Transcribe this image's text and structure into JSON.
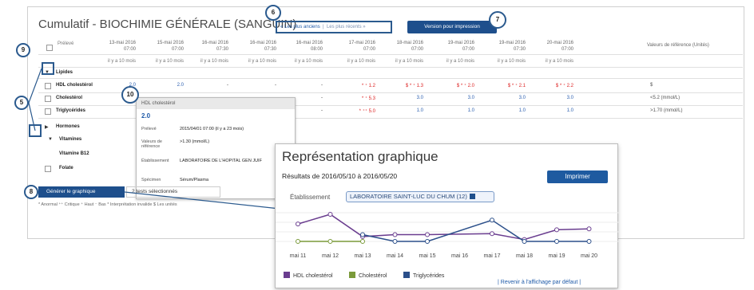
{
  "title": "Cumulatif - BIOCHIMIE GÉNÉRALE (SANGUIN)",
  "sort": {
    "oldest": "« Les plus anciens",
    "newest": "Les plus récents »"
  },
  "print_version": "Version pour impression",
  "header": {
    "preleve": "Prélevé",
    "ref": "Valeurs de référence (Unités)",
    "dates": [
      [
        "13-mai 2016",
        "07:00"
      ],
      [
        "15-mai 2016",
        "07:00"
      ],
      [
        "16-mai 2016",
        "07:30"
      ],
      [
        "16-mai 2016",
        "07:30"
      ],
      [
        "16-mai 2016",
        "08:00"
      ],
      [
        "17-mai 2016",
        "07:00"
      ],
      [
        "18-mai 2016",
        "07:00"
      ],
      [
        "19-mai 2016",
        "07:00"
      ],
      [
        "19-mai 2016",
        "07:30"
      ],
      [
        "20-mai 2016",
        "07:00"
      ]
    ],
    "ago": "il y a 10 mois"
  },
  "groups": {
    "lipides": "Lipides",
    "hormones": "Hormones",
    "vitamines": "Vitamines",
    "vitb12": "Vitamine B12",
    "folate": "Folate"
  },
  "rows": [
    {
      "name": "HDL cholestérol",
      "vals": [
        "2.0",
        "2.0",
        "-",
        "-",
        "-",
        "* ⁺ 1.2",
        "$ * ⁺ 1.3",
        "$ * ⁺ 2.0",
        "$ * ⁺ 2.1",
        "$ * ⁺ 2.2"
      ],
      "ref": "$"
    },
    {
      "name": "Cholestérol",
      "vals": [
        "",
        "",
        "-",
        "-",
        "-",
        "* ⁺ 5.3",
        "3.0",
        "3.0",
        "3.0",
        "3.0"
      ],
      "ref": "<5.2 (mmol/L)"
    },
    {
      "name": "Triglycérides",
      "vals": [
        "",
        "",
        "-",
        "-",
        "-",
        "* ⁺⁺ 5.0",
        "1.0",
        "1.0",
        "1.0",
        "1.0"
      ],
      "ref": ">1.70 (mmol/L)"
    }
  ],
  "popup": {
    "title": "HDL cholestérol",
    "value": "2.0",
    "l1": "Prélevé",
    "v1": "2015/04/01 07:00 (il y a 23 mois)",
    "l2": "Valeurs de référence",
    "v2": ">1.30 (mmol/L)",
    "l3": "Établissement",
    "v3": "LABORATOIRE DE L'HOPITAL GEN JUIF",
    "l4": "Spécimen",
    "v4": "Sérum/Plasma"
  },
  "generate": "Générer le graphique",
  "selected": "2 tests sélectionnés",
  "legend_text": "* Anormal   ⁺⁺ Critique   ⁺ Haut   ⁻ Bas   * Interprétation invalide   $ Les unités",
  "callouts": [
    "5",
    "6",
    "7",
    "8",
    "9",
    "10"
  ],
  "graph": {
    "title": "Représentation graphique",
    "range": "Résultats de 2016/05/10 à 2016/05/20",
    "print": "Imprimer",
    "estab_label": "Établissement",
    "estab": "LABORATOIRE SAINT-LUC DU CHUM (12)",
    "reset": "| Revenir à l'affichage par défaut |",
    "legend": [
      {
        "name": "HDL cholestérol",
        "color": "#6a3d8f"
      },
      {
        "name": "Cholestérol",
        "color": "#7a9a3a"
      },
      {
        "name": "Triglycérides",
        "color": "#2b4f8a"
      }
    ]
  },
  "chart_data": {
    "type": "line",
    "categories": [
      "mai 11",
      "mai 12",
      "mai 13",
      "mai 14",
      "mai 15",
      "mai 16",
      "mai 17",
      "mai 18",
      "mai 19",
      "mai 20"
    ],
    "series": [
      {
        "name": "HDL cholestérol",
        "points": [
          [
            0,
            0.9
          ],
          [
            1,
            1.4
          ],
          [
            2,
            0.25
          ],
          [
            3,
            0.35
          ],
          [
            4,
            0.35
          ],
          [
            6,
            0.4
          ],
          [
            7,
            0.1
          ],
          [
            8,
            0.6
          ],
          [
            9,
            0.65
          ]
        ]
      },
      {
        "name": "Cholestérol",
        "points": [
          [
            0,
            0
          ],
          [
            1,
            0
          ],
          [
            2,
            0
          ]
        ]
      },
      {
        "name": "Triglycérides",
        "points": [
          [
            2,
            0.35
          ],
          [
            3,
            0
          ],
          [
            4,
            0
          ],
          [
            6,
            1.1
          ],
          [
            7,
            0
          ],
          [
            8,
            0
          ],
          [
            9,
            0
          ]
        ]
      }
    ]
  }
}
